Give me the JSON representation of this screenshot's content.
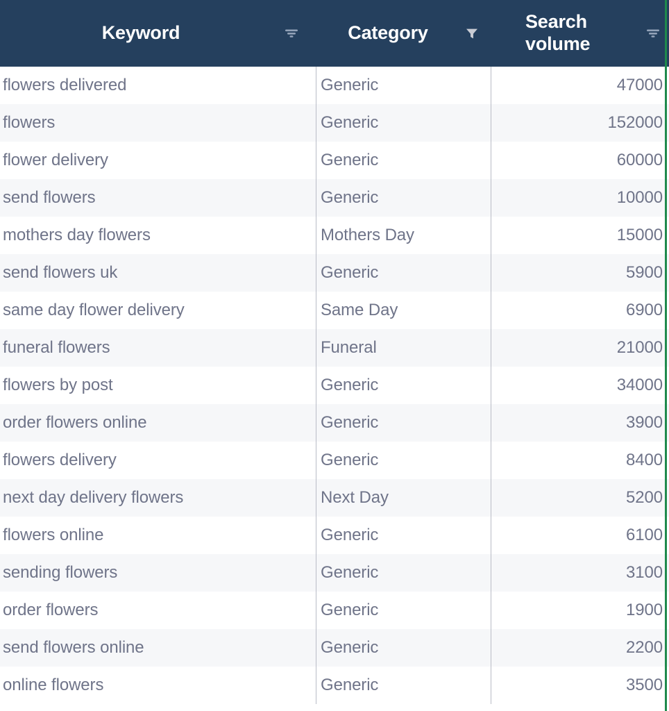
{
  "table": {
    "columns": [
      {
        "id": "keyword",
        "label": "Keyword",
        "filter_icon": "filter-lines-icon",
        "filter_active": false,
        "align": "left"
      },
      {
        "id": "category",
        "label": "Category",
        "filter_icon": "filter-funnel-solid-icon",
        "filter_active": true,
        "align": "left"
      },
      {
        "id": "search_volume",
        "label": "Search\nvolume",
        "filter_icon": "filter-lines-icon",
        "filter_active": false,
        "align": "right"
      }
    ],
    "rows": [
      {
        "keyword": "flowers delivered",
        "category": "Generic",
        "search_volume": "47000"
      },
      {
        "keyword": "flowers",
        "category": "Generic",
        "search_volume": "152000"
      },
      {
        "keyword": "flower delivery",
        "category": "Generic",
        "search_volume": "60000"
      },
      {
        "keyword": "send flowers",
        "category": "Generic",
        "search_volume": "10000"
      },
      {
        "keyword": "mothers day flowers",
        "category": "Mothers Day",
        "search_volume": "15000"
      },
      {
        "keyword": "send flowers uk",
        "category": "Generic",
        "search_volume": "5900"
      },
      {
        "keyword": "same day flower delivery",
        "category": "Same Day",
        "search_volume": "6900"
      },
      {
        "keyword": "funeral flowers",
        "category": "Funeral",
        "search_volume": "21000"
      },
      {
        "keyword": "flowers by post",
        "category": "Generic",
        "search_volume": "34000"
      },
      {
        "keyword": "order flowers online",
        "category": "Generic",
        "search_volume": "3900"
      },
      {
        "keyword": "flowers delivery",
        "category": "Generic",
        "search_volume": "8400"
      },
      {
        "keyword": "next day delivery flowers",
        "category": "Next Day",
        "search_volume": "5200"
      },
      {
        "keyword": "flowers online",
        "category": "Generic",
        "search_volume": "6100"
      },
      {
        "keyword": "sending flowers",
        "category": "Generic",
        "search_volume": "3100"
      },
      {
        "keyword": "order flowers",
        "category": "Generic",
        "search_volume": "1900"
      },
      {
        "keyword": "send flowers online",
        "category": "Generic",
        "search_volume": "2200"
      },
      {
        "keyword": "online flowers",
        "category": "Generic",
        "search_volume": "3500"
      }
    ]
  },
  "colors": {
    "header_bg": "#25405e",
    "header_text": "#ffffff",
    "row_bg": "#ffffff",
    "row_alt_bg": "#f6f7f9",
    "cell_text": "#6f7489",
    "divider": "#b9bcc6",
    "filter_icon": "#c9ccd4",
    "filter_icon_muted": "#93a2b8",
    "accent_edge": "#1f8a4c"
  }
}
